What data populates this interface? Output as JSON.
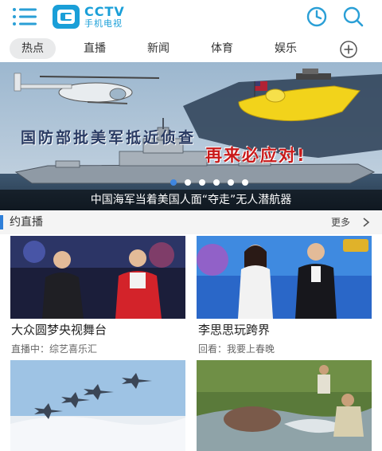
{
  "header": {
    "logo_text": "CCTV",
    "logo_subtext": "手机电视",
    "icons": [
      "menu-icon",
      "history-icon",
      "search-icon"
    ]
  },
  "tabs": [
    {
      "label": "热点",
      "active": true
    },
    {
      "label": "直播",
      "active": false
    },
    {
      "label": "新闻",
      "active": false
    },
    {
      "label": "体育",
      "active": false
    },
    {
      "label": "娱乐",
      "active": false
    }
  ],
  "banner": {
    "headline": "国防部批美军抵近侦查",
    "slogan": "再来必应对!",
    "caption": "中国海军当着美国人面“夺走”无人潜航器",
    "slide_count": 6,
    "active_slide": 0
  },
  "section": {
    "title": "约直播",
    "more_label": "更多"
  },
  "cards": [
    {
      "title": "大众圆梦央视舞台",
      "subtitle": "直播中：综艺喜乐汇"
    },
    {
      "title": "李思思玩跨界",
      "subtitle": "回看：我要上春晚"
    }
  ],
  "colors": {
    "accent": "#2e7fd9",
    "brand": "#1a9fd8",
    "slogan_red": "#c91a1a"
  }
}
